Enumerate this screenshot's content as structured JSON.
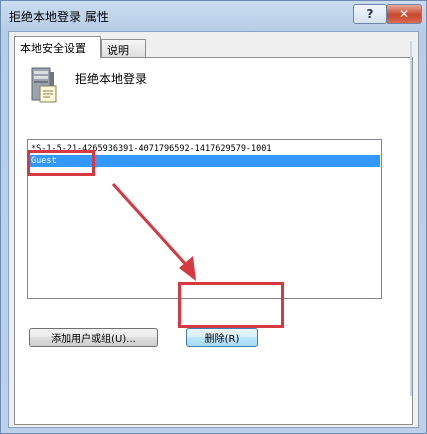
{
  "window": {
    "title": "拒绝本地登录 属性",
    "help_label": "?",
    "close_label": "✕"
  },
  "tabs": [
    {
      "label": "本地安全设置",
      "active": true
    },
    {
      "label": "说明",
      "active": false
    }
  ],
  "policy": {
    "icon": "server-policy-icon",
    "name": "拒绝本地登录"
  },
  "list": {
    "items": [
      {
        "text": "*S-1-5-21-4265936391-4071796592-1417629579-1001",
        "selected": false
      },
      {
        "text": "Guest",
        "selected": true
      }
    ]
  },
  "buttons": {
    "add_label": "添加用户或组(U)...",
    "remove_label": "删除(R)"
  },
  "annotations": {
    "color": "#d6393f"
  }
}
